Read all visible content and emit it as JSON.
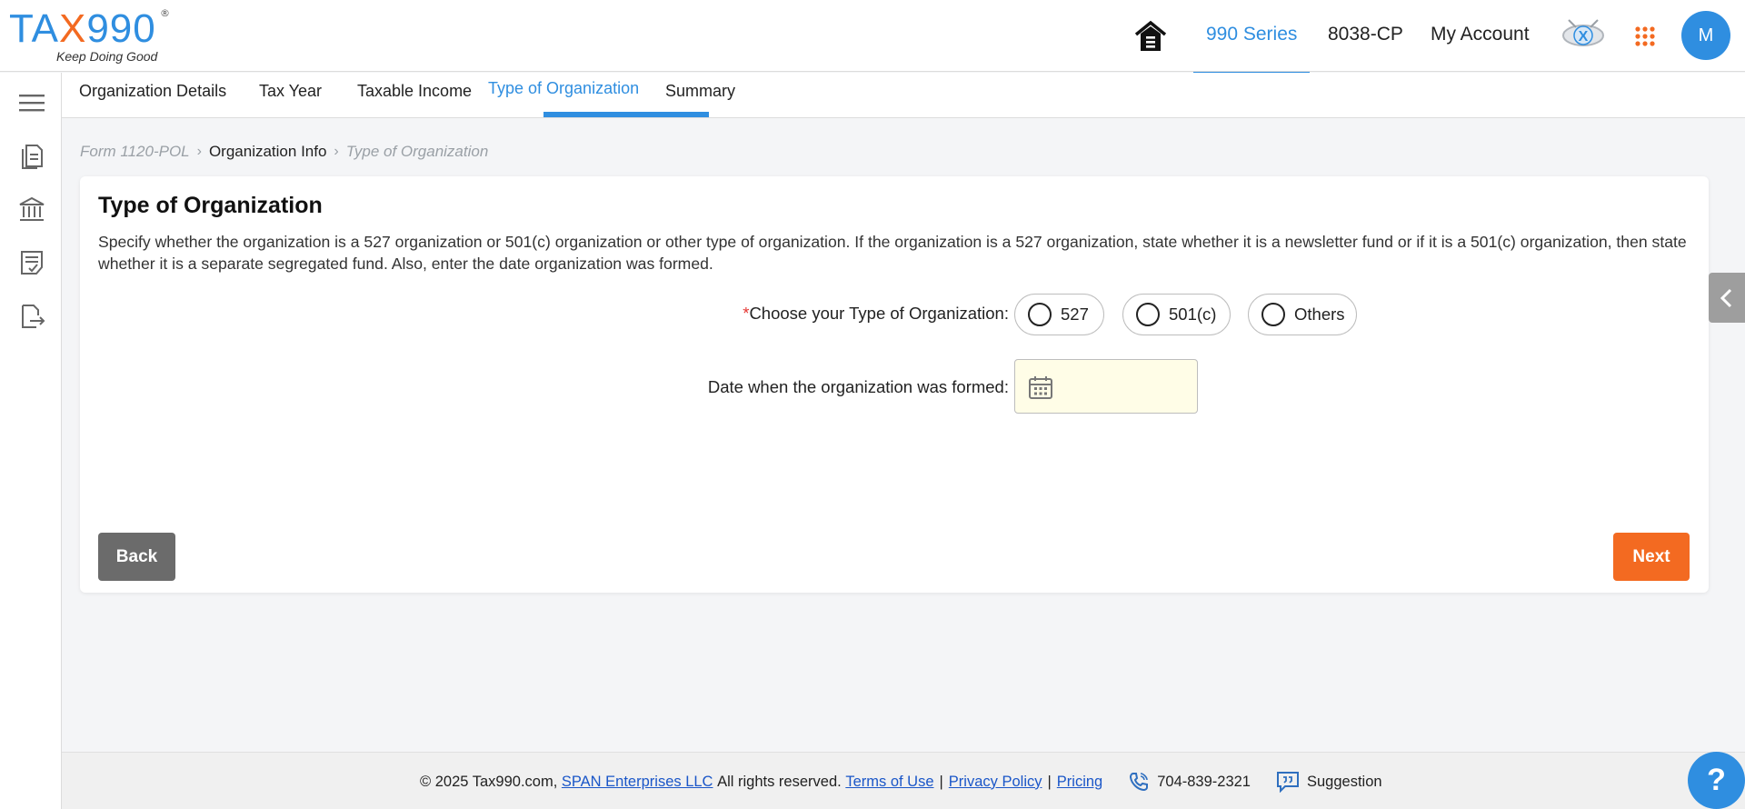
{
  "brand": {
    "logo_tax": "TA",
    "logo_x": "X",
    "logo_num": "990",
    "logo_reg": "®",
    "tagline": "Keep Doing Good",
    "primary_color": "#2f8ee0",
    "accent_color": "#f36a21"
  },
  "header": {
    "home_icon": "home-icon",
    "nav": [
      {
        "label": "990 Series",
        "active": true
      },
      {
        "label": "8038-CP",
        "active": false
      },
      {
        "label": "My Account",
        "active": false
      }
    ],
    "x_badge_letter": "X",
    "apps_icon": "apps-grid-icon",
    "avatar_initial": "M"
  },
  "sidebar": {
    "icons": [
      "menu-icon",
      "documents-icon",
      "bank-icon",
      "checklist-icon",
      "file-export-icon"
    ]
  },
  "subtabs": [
    {
      "label": "Organization Details",
      "active": false
    },
    {
      "label": "Tax Year",
      "active": false
    },
    {
      "label": "Taxable Income",
      "active": false
    },
    {
      "label": "Type of Organization",
      "active": true
    },
    {
      "label": "Summary",
      "active": false
    }
  ],
  "breadcrumb": {
    "item1": "Form 1120-POL",
    "item2": "Organization Info",
    "item3": "Type of Organization"
  },
  "card": {
    "title": "Type of Organization",
    "description": "Specify whether the organization is a 527 organization or 501(c) organization or other type of organization. If the organization is a 527 organization, state whether it is a newsletter fund or if it is a 501(c) organization, then state whether it is a separate segregated fund. Also, enter the date organization was formed.",
    "org_type": {
      "required_mark": "*",
      "label": "Choose your Type of Organization:",
      "options": [
        "527",
        "501(c)",
        "Others"
      ]
    },
    "date_formed": {
      "label": "Date when the organization was formed:",
      "value": ""
    },
    "back_label": "Back",
    "next_label": "Next"
  },
  "footer": {
    "copyright": "© 2025 Tax990.com,",
    "company_link": "SPAN Enterprises LLC",
    "rights": "All rights reserved.",
    "terms": "Terms of Use",
    "privacy": "Privacy Policy",
    "pricing": "Pricing",
    "phone": "704-839-2321",
    "suggestion": "Suggestion",
    "separator": "|"
  },
  "help_label": "?"
}
